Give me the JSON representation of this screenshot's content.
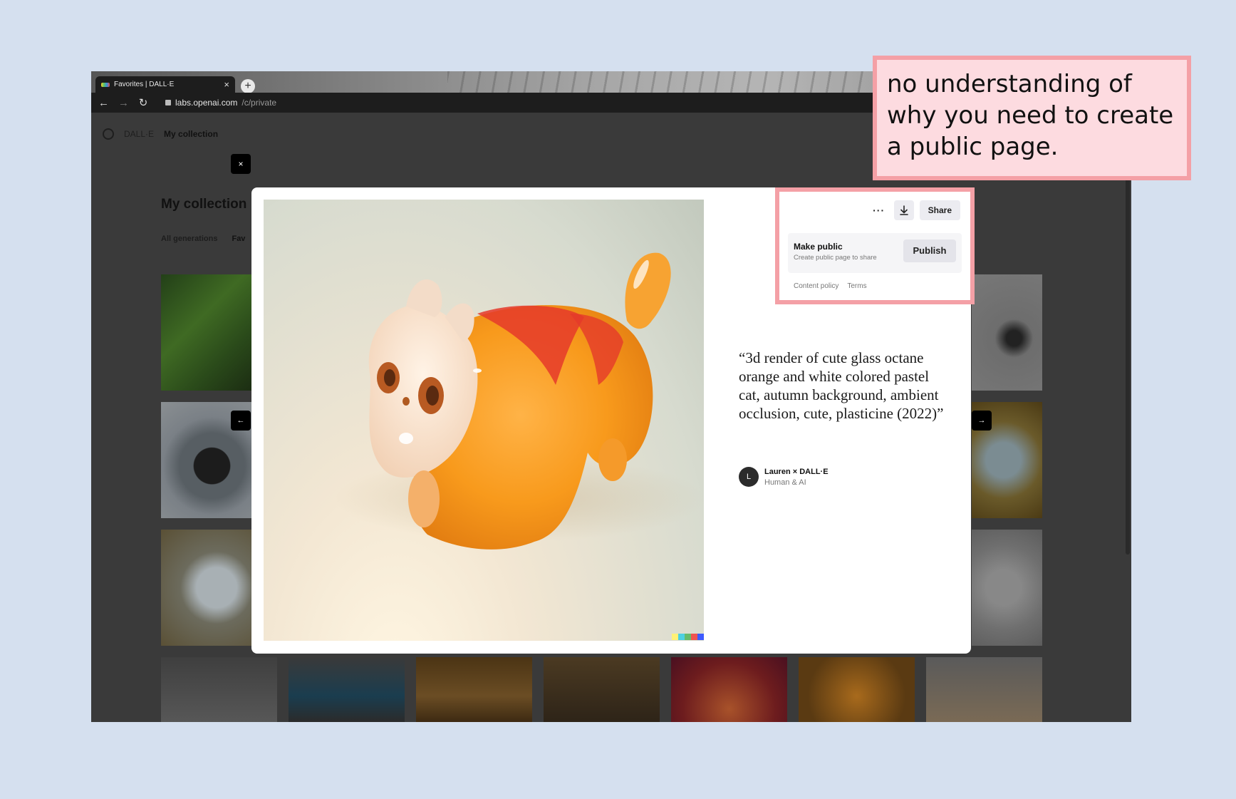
{
  "browser": {
    "tab_title": "Favorites | DALL·E",
    "tab_close": "×",
    "new_tab": "+",
    "back": "←",
    "forward": "→",
    "reload": "↻",
    "url_host": "labs.openai.com",
    "url_path": "/c/private"
  },
  "app": {
    "brand": "DALL·E",
    "current_section": "My collection",
    "page_title": "My collection",
    "filters": [
      "All generations",
      "Fav"
    ]
  },
  "modal": {
    "close": "×",
    "prev": "←",
    "next": "→",
    "prompt": "“3d render of cute glass octane orange and white colored pastel cat, autumn background, ambient occlusion, cute, plasticine (2022)”",
    "author": {
      "initial": "L",
      "name": "Lauren × DALL·E",
      "subtitle": "Human & AI"
    }
  },
  "share_popover": {
    "more": "···",
    "download_icon": "download-icon",
    "share_label": "Share",
    "make_public_title": "Make public",
    "make_public_subtitle": "Create public page to share",
    "publish_label": "Publish",
    "links": [
      "Content policy",
      "Terms"
    ]
  },
  "annotation": {
    "text": "no understanding of why you need to create a public page."
  },
  "colors": {
    "highlight": "#f4a0a6",
    "callout_fill": "#fddbe0",
    "background": "#d5e0ef"
  }
}
